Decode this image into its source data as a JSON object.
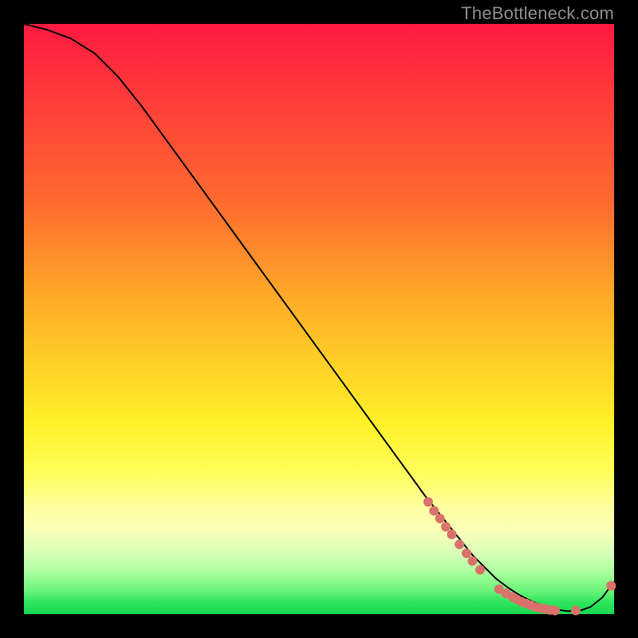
{
  "watermark": {
    "text": "TheBottleneck.com"
  },
  "colors": {
    "curve": "#000000",
    "dot": "#d9726a",
    "background": "#000000"
  },
  "chart_data": {
    "type": "line",
    "title": "",
    "xlabel": "",
    "ylabel": "",
    "xlim": [
      0,
      100
    ],
    "ylim": [
      0,
      100
    ],
    "grid": false,
    "series": [
      {
        "name": "bottleneck-curve",
        "x": [
          0,
          4,
          8,
          12,
          16,
          20,
          24,
          28,
          32,
          36,
          40,
          44,
          48,
          52,
          56,
          60,
          64,
          68,
          70,
          72,
          74,
          76,
          78,
          80,
          82,
          84,
          86,
          88,
          90,
          92,
          94,
          96,
          98,
          100
        ],
        "y": [
          100,
          99,
          97.5,
          95,
          91,
          86,
          80.5,
          75,
          69.5,
          64,
          58.5,
          53,
          47.5,
          42,
          36.5,
          31,
          25.5,
          20,
          17.5,
          15,
          12.5,
          10,
          8,
          6,
          4.5,
          3.2,
          2.2,
          1.4,
          0.8,
          0.5,
          0.5,
          1.2,
          2.8,
          5.5
        ]
      }
    ],
    "markers": [
      {
        "x": 68.5,
        "y": 19.0
      },
      {
        "x": 69.5,
        "y": 17.5
      },
      {
        "x": 70.5,
        "y": 16.2
      },
      {
        "x": 71.5,
        "y": 14.8
      },
      {
        "x": 72.5,
        "y": 13.5
      },
      {
        "x": 73.8,
        "y": 11.8
      },
      {
        "x": 75.0,
        "y": 10.3
      },
      {
        "x": 76.0,
        "y": 9.0
      },
      {
        "x": 77.3,
        "y": 7.5
      },
      {
        "x": 80.5,
        "y": 4.2
      },
      {
        "x": 81.7,
        "y": 3.5
      },
      {
        "x": 82.8,
        "y": 2.9
      },
      {
        "x": 83.5,
        "y": 2.5
      },
      {
        "x": 84.3,
        "y": 2.1
      },
      {
        "x": 85.1,
        "y": 1.8
      },
      {
        "x": 85.9,
        "y": 1.5
      },
      {
        "x": 86.7,
        "y": 1.2
      },
      {
        "x": 87.5,
        "y": 1.0
      },
      {
        "x": 88.3,
        "y": 0.9
      },
      {
        "x": 89.1,
        "y": 0.7
      },
      {
        "x": 90.0,
        "y": 0.6
      },
      {
        "x": 93.5,
        "y": 0.6
      },
      {
        "x": 99.5,
        "y": 4.8
      }
    ]
  }
}
